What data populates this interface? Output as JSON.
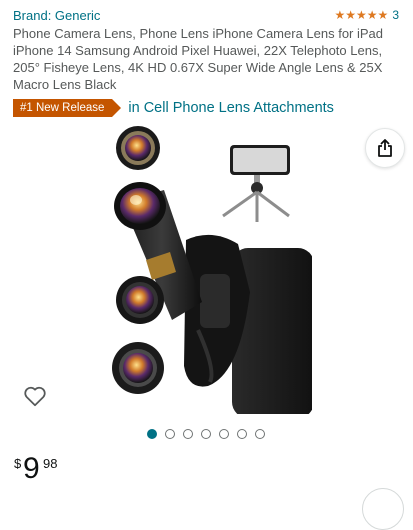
{
  "product": {
    "brand": "Brand: Generic",
    "rating_count": "3",
    "stars": 5,
    "title": "Phone Camera Lens, Phone Lens iPhone Camera Lens for iPad iPhone 14 Samsung Android Pixel Huawei, 22X Telephoto Lens, 205° Fisheye Lens, 4K HD 0.67X Super Wide Angle Lens & 25X Macro Lens Black",
    "badge": "#1 New Release",
    "badge_category": "in Cell Phone Lens Attachments",
    "price": {
      "symbol": "$",
      "whole": "9",
      "fraction": "98"
    }
  },
  "carousel": {
    "count": 7,
    "active_index": 0
  },
  "icons": {
    "share": "share-icon",
    "wishlist": "heart-icon"
  },
  "colors": {
    "link": "#007185",
    "star": "#de7921",
    "badge": "#c45500",
    "title_text": "#565959"
  }
}
